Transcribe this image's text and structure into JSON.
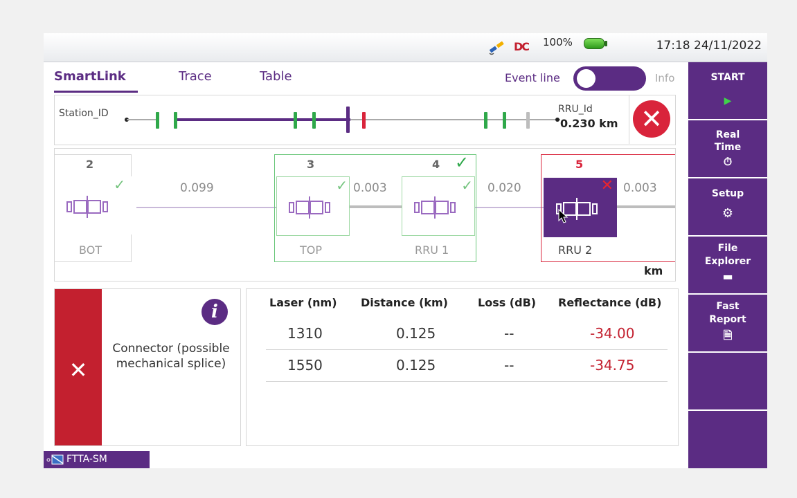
{
  "status": {
    "battery": "100%",
    "time": "17:18",
    "date": "24/11/2022"
  },
  "tabs": [
    {
      "label": "SmartLink"
    },
    {
      "label": "Trace"
    },
    {
      "label": "Table"
    }
  ],
  "event_line": {
    "label": "Event line",
    "info_label": "Info",
    "enabled": true
  },
  "link": {
    "start_label": "Station_ID",
    "end_label": "RRU_Id",
    "end_distance": "0.230 km",
    "status": "fail"
  },
  "diagram": {
    "unit": "km",
    "events": [
      {
        "number": "2",
        "label": "BOT",
        "status": "pass"
      },
      {
        "number": "3",
        "label": "TOP",
        "status": "pass"
      },
      {
        "number": "4",
        "label": "RRU 1",
        "status": "pass"
      },
      {
        "number": "5",
        "label": "RRU 2",
        "status": "fail",
        "selected": true
      }
    ],
    "distances": [
      "0.099",
      "0.003",
      "0.020",
      "0.003"
    ]
  },
  "event_detail": {
    "description": "Connector (possible mechanical splice)",
    "status": "fail"
  },
  "table": {
    "headers": [
      "Laser (nm)",
      "Distance (km)",
      "Loss  (dB)",
      "Reflectance (dB)"
    ],
    "rows": [
      {
        "laser": "1310",
        "distance": "0.125",
        "loss": "--",
        "reflectance": "-34.00"
      },
      {
        "laser": "1550",
        "distance": "0.125",
        "loss": "--",
        "reflectance": "-34.75"
      }
    ]
  },
  "sidebar": {
    "buttons": [
      {
        "label": "START",
        "icon": "play-icon"
      },
      {
        "label": "Real Time",
        "icon": "stopwatch-icon"
      },
      {
        "label": "Setup",
        "icon": "gear-icon"
      },
      {
        "label": "File Explorer",
        "icon": "folder-icon"
      },
      {
        "label": "Fast Report",
        "icon": "report-icon"
      }
    ]
  },
  "app": {
    "label": "FTTA-SM"
  },
  "colors": {
    "accent": "#5b2c83",
    "pass": "#2fa84a",
    "fail": "#d9243b"
  }
}
